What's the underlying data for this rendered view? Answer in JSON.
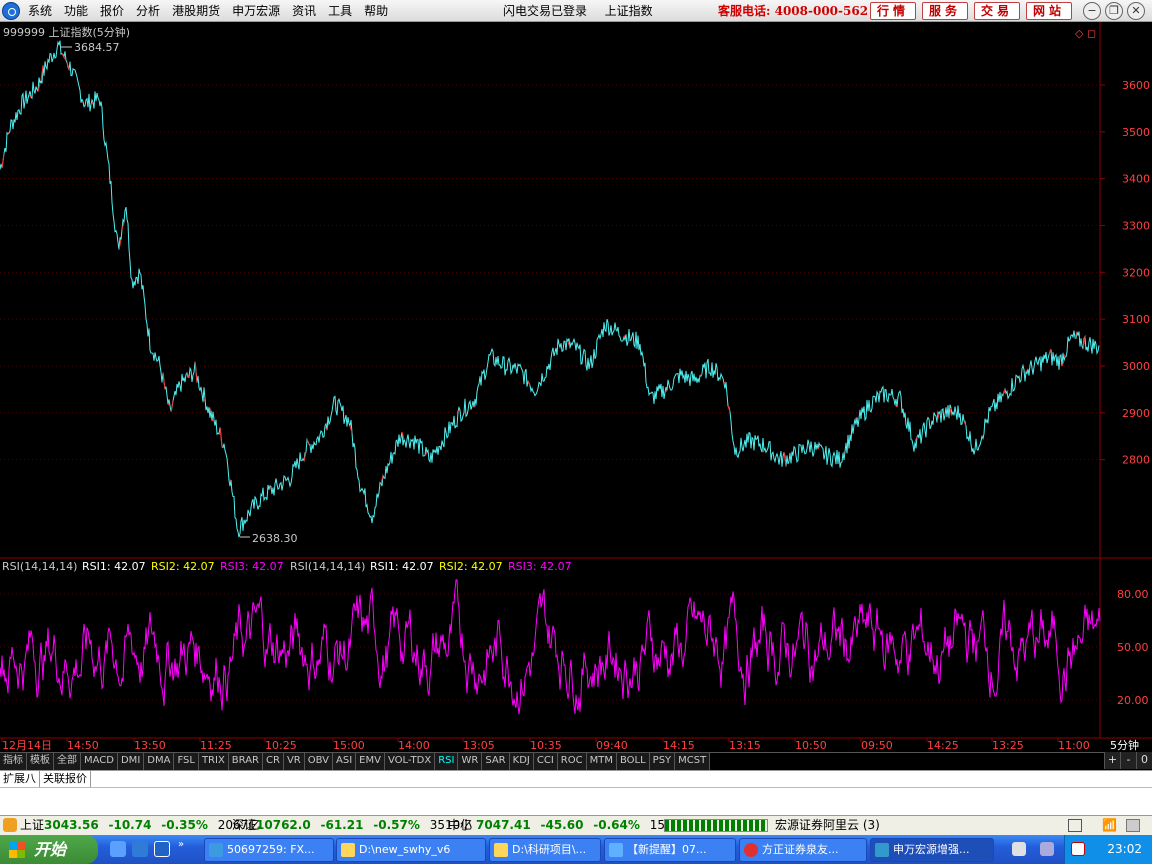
{
  "menubar": {
    "menus": [
      "系统",
      "功能",
      "报价",
      "分析",
      "港股期货",
      "申万宏源",
      "资讯",
      "工具",
      "帮助"
    ],
    "status": "闪电交易已登录",
    "index_name": "上证指数",
    "hotline": "客服电话: 4008-000-562",
    "buttons": [
      "行情",
      "服务",
      "交易",
      "网站"
    ]
  },
  "chart": {
    "title": "999999 上证指数(5分钟)",
    "high_label": "3684.57",
    "low_label": "2638.30",
    "price_ticks": [
      "3600",
      "3500",
      "3400",
      "3300",
      "3200",
      "3100",
      "3000",
      "2900",
      "2800"
    ],
    "price_values": [
      3600,
      3500,
      3400,
      3300,
      3200,
      3100,
      3000,
      2900,
      2800
    ],
    "rsi_header": [
      "RSI(14,14,14)",
      "RSI1: 42.07",
      "RSI2: 42.07",
      "RSI3: 42.07",
      "RSI(14,14,14)",
      "RSI1: 42.07",
      "RSI2: 42.07",
      "RSI3: 42.07"
    ],
    "rsi_ticks": [
      "80.00",
      "50.00",
      "20.00"
    ],
    "rsi_values": [
      80,
      50,
      20
    ],
    "time_labels": [
      "12月14日",
      "14:50",
      "13:50",
      "11:25",
      "10:25",
      "15:00",
      "14:00",
      "13:05",
      "10:35",
      "09:40",
      "14:15",
      "13:15",
      "10:50",
      "09:50",
      "14:25",
      "13:25",
      "11:00"
    ],
    "period": "5分钟",
    "colors": {
      "up": "#ff3030",
      "down": "#50f0f0",
      "rsi": "#ff00ff",
      "grid": "#8b0000",
      "axis_text": "#ff4040"
    }
  },
  "tabs": {
    "items": [
      "指标",
      "模板",
      "全部",
      "MACD",
      "DMI",
      "DMA",
      "FSL",
      "TRIX",
      "BRAR",
      "CR",
      "VR",
      "OBV",
      "ASI",
      "EMV",
      "VOL-TDX",
      "RSI",
      "WR",
      "SAR",
      "KDJ",
      "CCI",
      "ROC",
      "MTM",
      "BOLL",
      "PSY",
      "MCST"
    ],
    "active": "RSI",
    "right": [
      "+",
      "-",
      "0"
    ]
  },
  "subtabs": [
    "扩展八",
    "关联报价"
  ],
  "quotes": {
    "sh": {
      "name": "上证",
      "value": "3043.56",
      "change": "-10.74",
      "pct": "-0.35%",
      "amount": "2067亿"
    },
    "sz": {
      "name": "深证",
      "value": "10762.0",
      "change": "-61.21",
      "pct": "-0.57%",
      "amount": "3510亿"
    },
    "zx": {
      "name": "中小",
      "value": "7047.41",
      "change": "-45.60",
      "pct": "-0.64%",
      "amount": "1588亿"
    },
    "broker": "宏源证券阿里云 (3)"
  },
  "taskbar": {
    "start": "开始",
    "tasks": [
      "50697259: FX...",
      "D:\\new_swhy_v6",
      "D:\\科研项目\\...",
      "【新提醒】07...",
      "方正证券泉友...",
      "申万宏源增强..."
    ],
    "clock": "23:02"
  }
}
